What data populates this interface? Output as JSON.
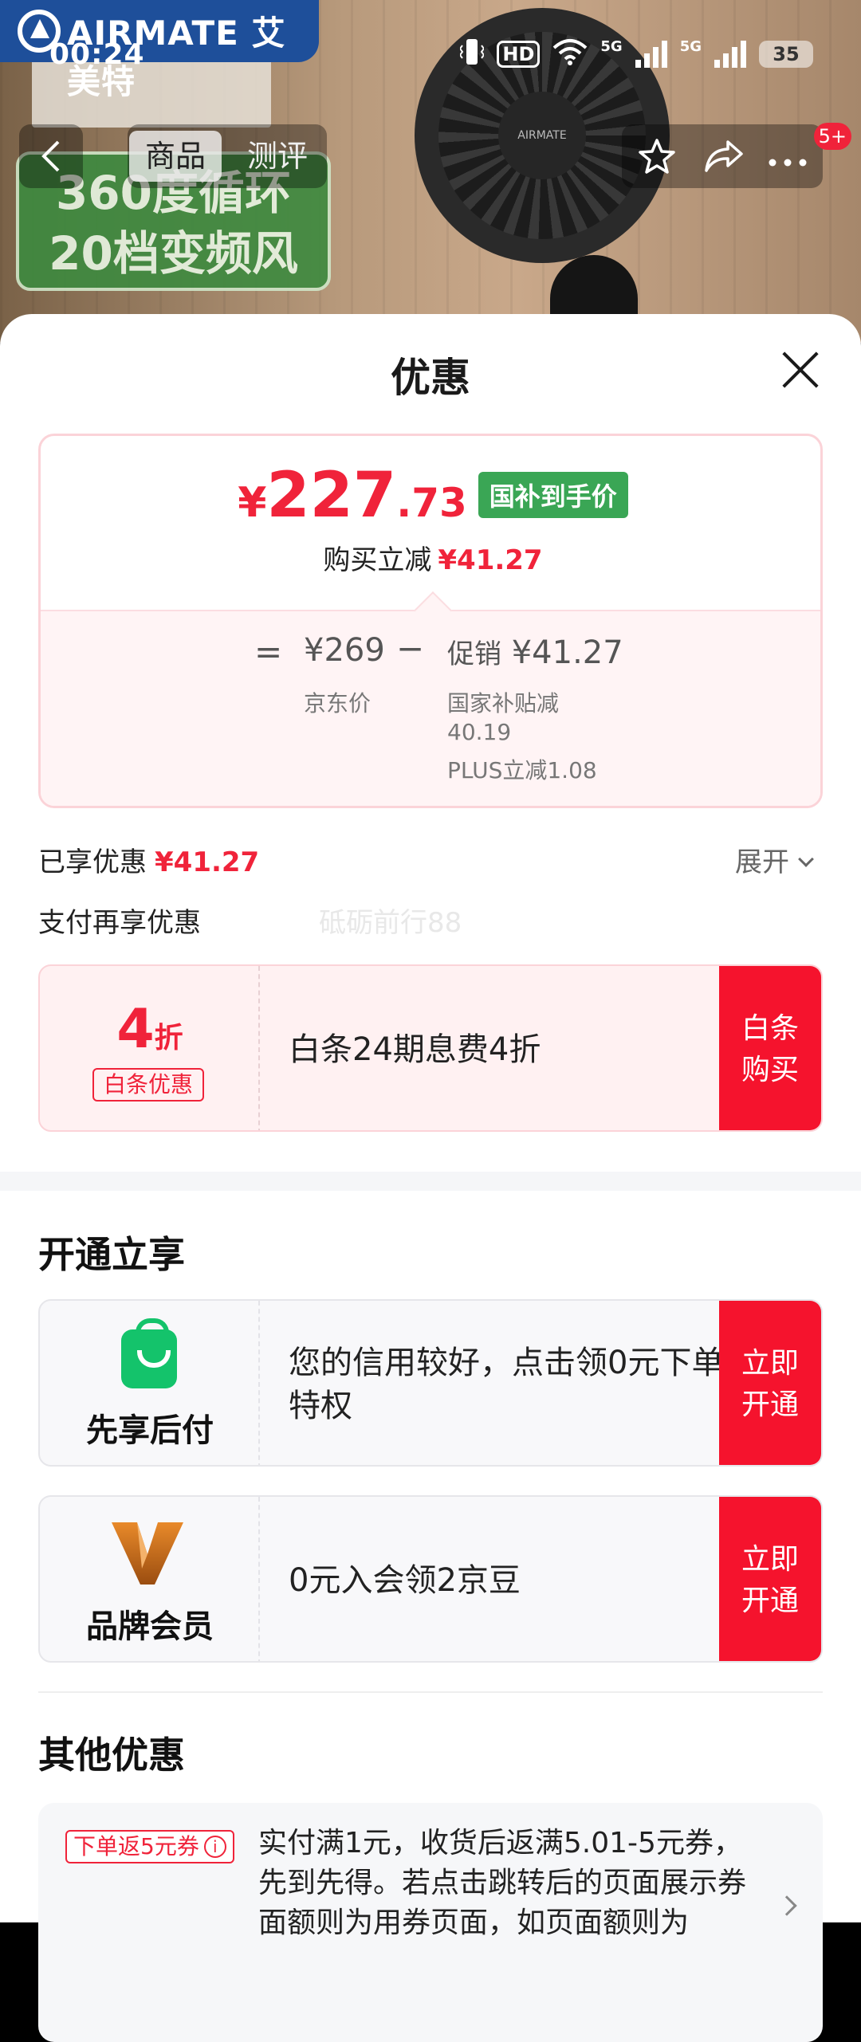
{
  "status_bar": {
    "time": "00:24",
    "hd_label": "HD",
    "net1": "5G",
    "net2": "5G",
    "battery": "35"
  },
  "background": {
    "brand_text": "AIRMATE 艾美特",
    "promo_lines": [
      "360度循环",
      "20档变频风"
    ],
    "fan_logo": "AIRMATE"
  },
  "nav": {
    "back_icon": "chevron-left-icon",
    "tabs": [
      {
        "label": "商品",
        "active": true
      },
      {
        "label": "测评",
        "active": false
      }
    ],
    "actions": [
      "star-icon",
      "share-icon",
      "more-icon"
    ],
    "badge": "5+"
  },
  "sheet": {
    "title": "优惠",
    "price": {
      "yen": "¥",
      "integer": "227",
      "decimal": ".73",
      "tag": "国补到手价",
      "sub_label": "购买立减",
      "sub_value": "¥41.27"
    },
    "breakdown": {
      "equals": "=",
      "jd_price": "¥269",
      "jd_caption": "京东价",
      "minus": "−",
      "promo_label": "促销",
      "promo_value": "¥41.27",
      "promo_details": [
        "国家补贴减",
        "40.19",
        "PLUS立减1.08"
      ]
    },
    "enjoyed_label": "已享优惠",
    "enjoyed_value": "¥41.27",
    "expand_label": "展开",
    "pay_title": "支付再享优惠",
    "watermark": "砥砺前行88",
    "baitiao": {
      "discount_num": "4",
      "discount_unit": "折",
      "pill": "白条优惠",
      "desc": "白条24期息费4折",
      "cta_lines": [
        "白条",
        "购买"
      ]
    },
    "open_section_title": "开通立享",
    "members": [
      {
        "icon": "shopping-bag-icon",
        "name": "先享后付",
        "desc": "您的信用较好，点击领0元下单特权",
        "cta_lines": [
          "立即",
          "开通"
        ],
        "icon_color": "#14c36b"
      },
      {
        "icon": "brand-v-icon",
        "name": "品牌会员",
        "desc": "0元入会领2京豆",
        "cta_lines": [
          "立即",
          "开通"
        ],
        "icon_color": "#d6791f"
      }
    ],
    "other_section_title": "其他优惠",
    "other": {
      "tag": "下单返5元券",
      "tag_icon": "info-icon",
      "desc": "实付满1元，收货后返满5.01-5元券，先到先得。若点击跳转后的页面展示券面额则为用券页面，如页面额则为"
    }
  },
  "colors": {
    "accent_red": "#f0233a",
    "cta_red": "#f5132d",
    "green_tag": "#3aa655"
  }
}
